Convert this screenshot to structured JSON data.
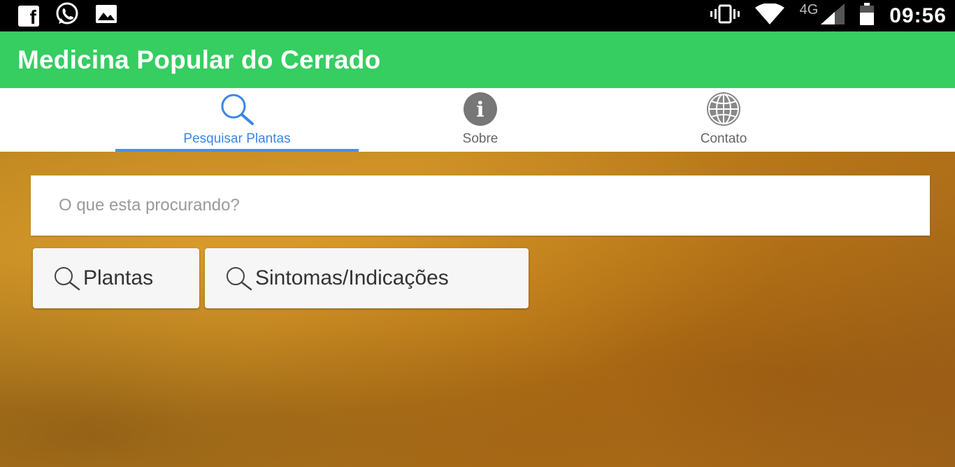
{
  "status_bar": {
    "left_icons": [
      "facebook-icon",
      "whatsapp-icon",
      "gallery-icon"
    ],
    "right_icons": [
      "vibrate-icon",
      "wifi-icon",
      "cell-signal-icon",
      "battery-icon"
    ],
    "network": "4G",
    "time": "09:56"
  },
  "app_bar": {
    "title": "Medicina Popular do Cerrado",
    "color": "#36cd61"
  },
  "tabs": [
    {
      "label": "Pesquisar Plantas",
      "icon": "search-icon",
      "active": true
    },
    {
      "label": "Sobre",
      "icon": "info-icon",
      "active": false
    },
    {
      "label": "Contato",
      "icon": "globe-icon",
      "active": false
    }
  ],
  "search": {
    "placeholder": "O que esta procurando?",
    "value": ""
  },
  "buttons": {
    "plants_label": "Plantas",
    "symptoms_label": "Sintomas/Indicações"
  },
  "colors": {
    "accent": "#3a86e6",
    "background_texture": "#b9821f"
  }
}
